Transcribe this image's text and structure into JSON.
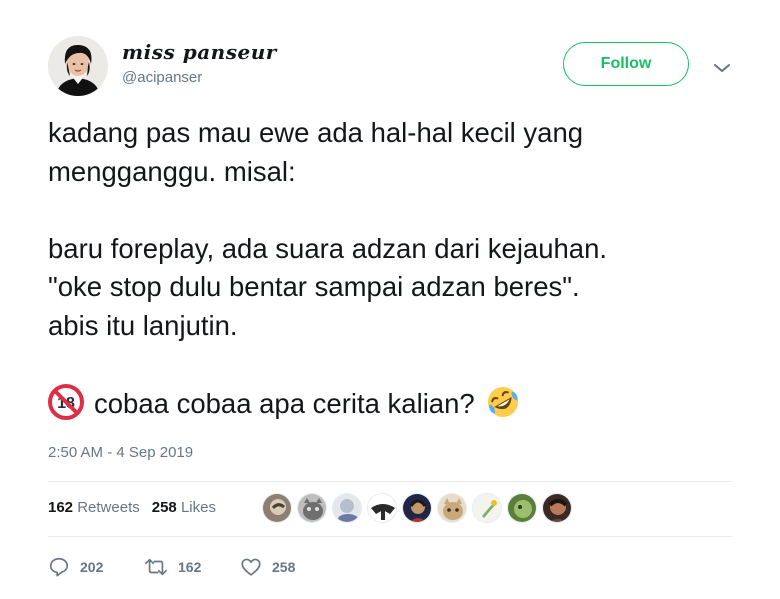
{
  "user": {
    "display_name": "miss panseur",
    "handle": "@acipanser",
    "avatar_icon": "user-avatar"
  },
  "follow_button": {
    "label": "Follow",
    "color": "#17bf63"
  },
  "menu": {
    "icon": "chevron-down-icon"
  },
  "tweet": {
    "lines": [
      "kadang pas mau ewe ada hal-hal kecil yang",
      "mengganggu. misal:",
      "",
      "baru foreplay, ada suara adzan dari kejauhan.",
      "\"oke stop dulu bentar sampai adzan beres\".",
      "abis itu lanjutin.",
      ""
    ],
    "last_line": "cobaa cobaa apa cerita kalian?",
    "emoji_before": "no-one-under-eighteen-emoji",
    "emoji_after": "rolling-on-floor-laughing-emoji"
  },
  "timestamp": "2:50 AM - 4 Sep 2019",
  "stats": {
    "retweets_count": "162",
    "retweets_label": "Retweets",
    "likes_count": "258",
    "likes_label": "Likes"
  },
  "liked_by_avatars": [
    "liker-avatar-1",
    "liker-avatar-2",
    "liker-avatar-3",
    "liker-avatar-4",
    "liker-avatar-5",
    "liker-avatar-6",
    "liker-avatar-7",
    "liker-avatar-8",
    "liker-avatar-9"
  ],
  "actions": {
    "reply_count": "202",
    "retweet_count": "162",
    "like_count": "258"
  },
  "colors": {
    "text": "#14171a",
    "secondary": "#657786",
    "accent_green": "#17bf63",
    "divider": "#e6ecf0"
  }
}
